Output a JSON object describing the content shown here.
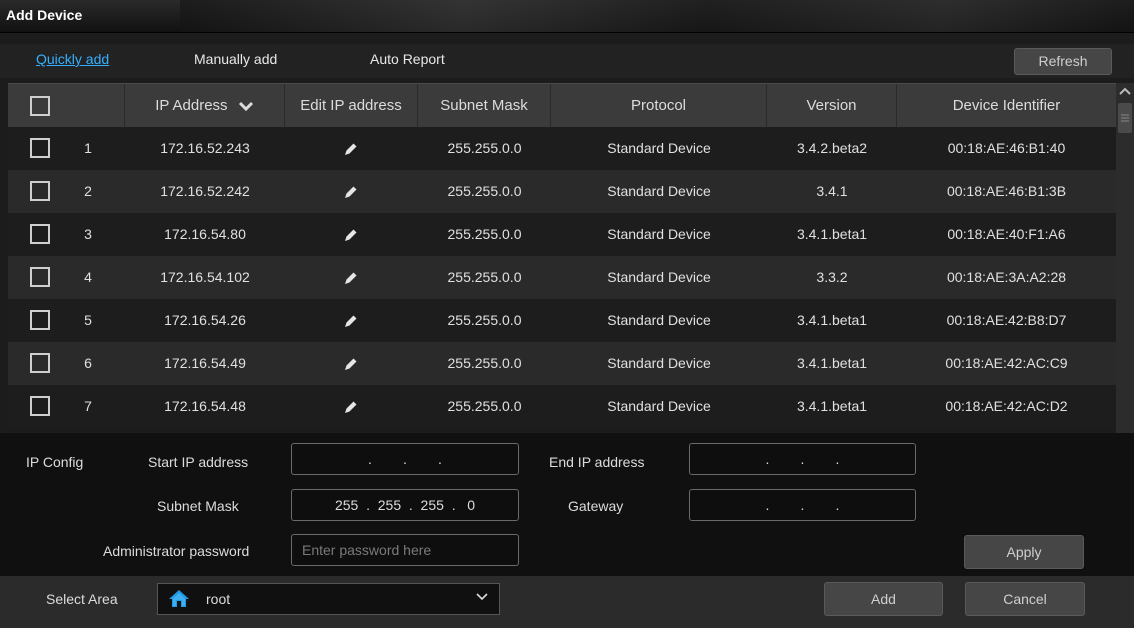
{
  "window": {
    "title": "Add Device"
  },
  "tabs": [
    {
      "label": "Quickly add",
      "active": true
    },
    {
      "label": "Manually add",
      "active": false
    },
    {
      "label": "Auto Report",
      "active": false
    }
  ],
  "refresh_label": "Refresh",
  "table": {
    "columns": [
      "IP Address",
      "Edit IP address",
      "Subnet Mask",
      "Protocol",
      "Version",
      "Device Identifier"
    ],
    "rows": [
      {
        "no": "1",
        "ip": "172.16.52.243",
        "mask": "255.255.0.0",
        "protocol": "Standard Device",
        "version": "3.4.2.beta2",
        "id": "00:18:AE:46:B1:40"
      },
      {
        "no": "2",
        "ip": "172.16.52.242",
        "mask": "255.255.0.0",
        "protocol": "Standard Device",
        "version": "3.4.1",
        "id": "00:18:AE:46:B1:3B"
      },
      {
        "no": "3",
        "ip": "172.16.54.80",
        "mask": "255.255.0.0",
        "protocol": "Standard Device",
        "version": "3.4.1.beta1",
        "id": "00:18:AE:40:F1:A6"
      },
      {
        "no": "4",
        "ip": "172.16.54.102",
        "mask": "255.255.0.0",
        "protocol": "Standard Device",
        "version": "3.3.2",
        "id": "00:18:AE:3A:A2:28"
      },
      {
        "no": "5",
        "ip": "172.16.54.26",
        "mask": "255.255.0.0",
        "protocol": "Standard Device",
        "version": "3.4.1.beta1",
        "id": "00:18:AE:42:B8:D7"
      },
      {
        "no": "6",
        "ip": "172.16.54.49",
        "mask": "255.255.0.0",
        "protocol": "Standard Device",
        "version": "3.4.1.beta1",
        "id": "00:18:AE:42:AC:C9"
      },
      {
        "no": "7",
        "ip": "172.16.54.48",
        "mask": "255.255.0.0",
        "protocol": "Standard Device",
        "version": "3.4.1.beta1",
        "id": "00:18:AE:42:AC:D2"
      }
    ]
  },
  "ipconfig": {
    "section_label": "IP Config",
    "start_ip_label": "Start IP address",
    "start_ip_value": ".        .        .",
    "end_ip_label": "End IP address",
    "end_ip_value": ".        .        .",
    "subnet_label": "Subnet Mask",
    "subnet_value": "255  .  255  .  255  .   0",
    "gateway_label": "Gateway",
    "gateway_value": ".        .        .",
    "admin_pwd_label": "Administrator password",
    "admin_pwd_placeholder": "Enter password here",
    "apply_label": "Apply"
  },
  "bottom": {
    "select_area_label": "Select Area",
    "area_value": "root",
    "add_label": "Add",
    "cancel_label": "Cancel"
  },
  "colors": {
    "accent": "#35b0ff",
    "home_icon": "#1e9be8"
  }
}
